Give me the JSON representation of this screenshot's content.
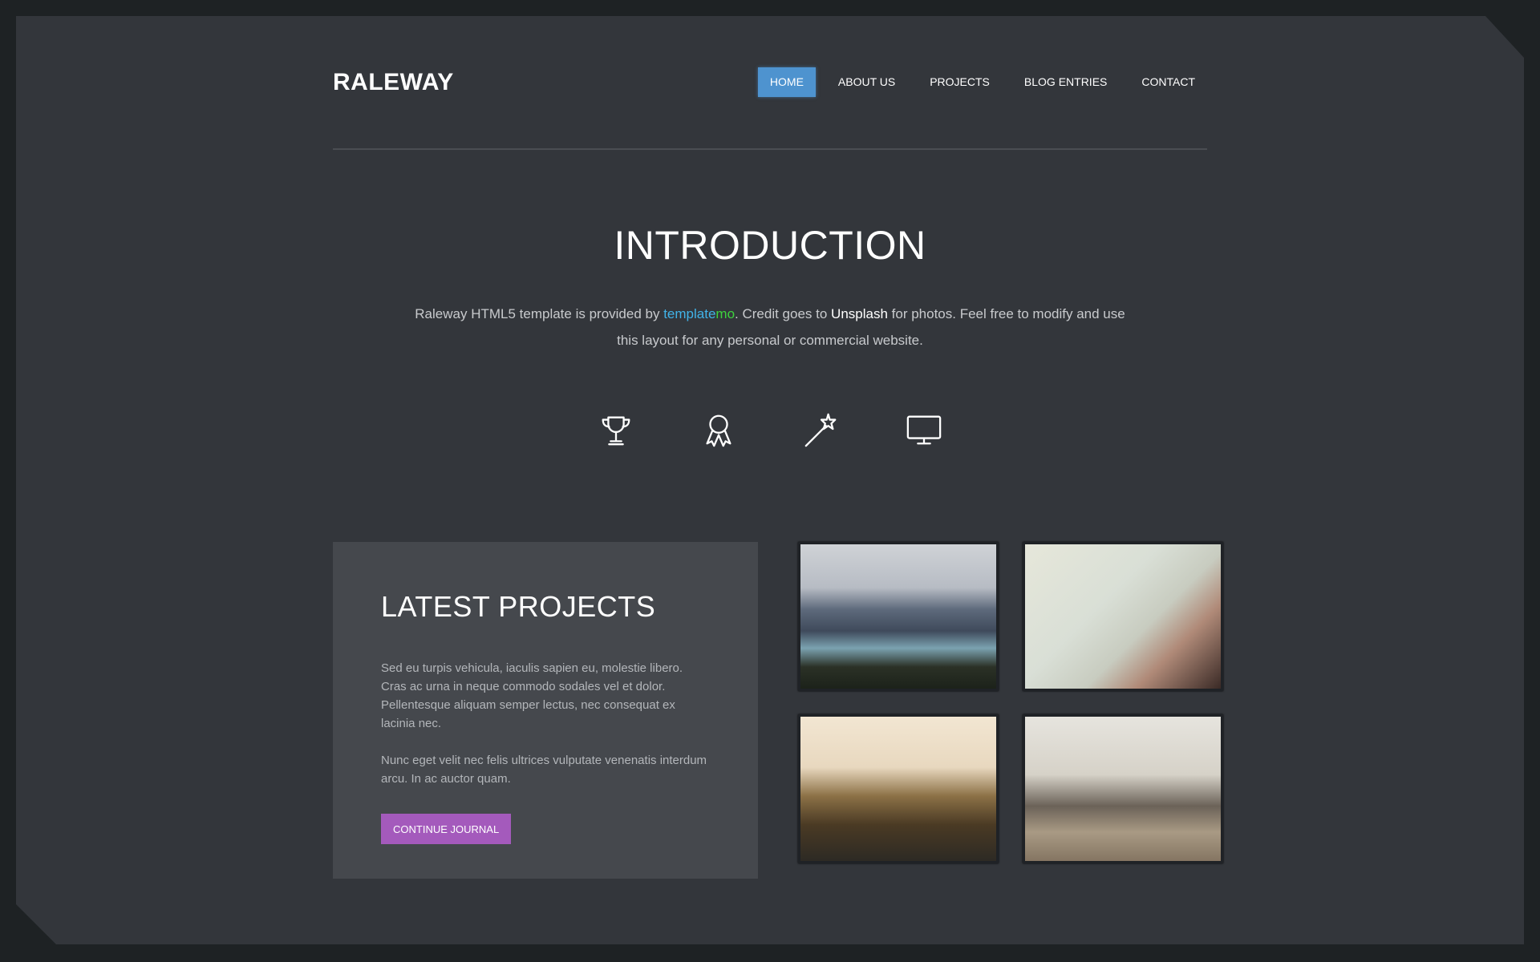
{
  "header": {
    "logo": "RALEWAY",
    "nav": [
      {
        "label": "HOME",
        "active": true
      },
      {
        "label": "ABOUT US",
        "active": false
      },
      {
        "label": "PROJECTS",
        "active": false
      },
      {
        "label": "BLOG ENTRIES",
        "active": false
      },
      {
        "label": "CONTACT",
        "active": false
      }
    ]
  },
  "intro": {
    "title": "INTRODUCTION",
    "text_before": "Raleway HTML5 template is provided by ",
    "link_part1": "template",
    "link_part2": "mo",
    "text_middle": ". Credit goes to ",
    "unsplash": "Unsplash",
    "text_after": " for photos. Feel free to modify and use this layout for any personal or commercial website.",
    "icons": [
      "trophy-icon",
      "award-ribbon-icon",
      "magic-wand-icon",
      "desktop-monitor-icon"
    ]
  },
  "projects": {
    "title": "LATEST PROJECTS",
    "paragraph1": "Sed eu turpis vehicula, iaculis sapien eu, molestie libero. Cras ac urna in neque commodo sodales vel et dolor. Pellentesque aliquam semper lectus, nec consequat ex lacinia nec.",
    "paragraph2": "Nunc eget velit nec felis ultrices vulputate venenatis interdum arcu. In ac auctor quam.",
    "button": "CONTINUE JOURNAL",
    "thumbnails": [
      {
        "subject": "mountain lake"
      },
      {
        "subject": "hands holding map"
      },
      {
        "subject": "coastal cliffs at sunset"
      },
      {
        "subject": "laptop on desk by window"
      }
    ]
  },
  "colors": {
    "accent_blue": "#4e93cf",
    "accent_purple": "#a45abc",
    "link_cyan": "#41b3e8",
    "link_green": "#3dd23d"
  }
}
